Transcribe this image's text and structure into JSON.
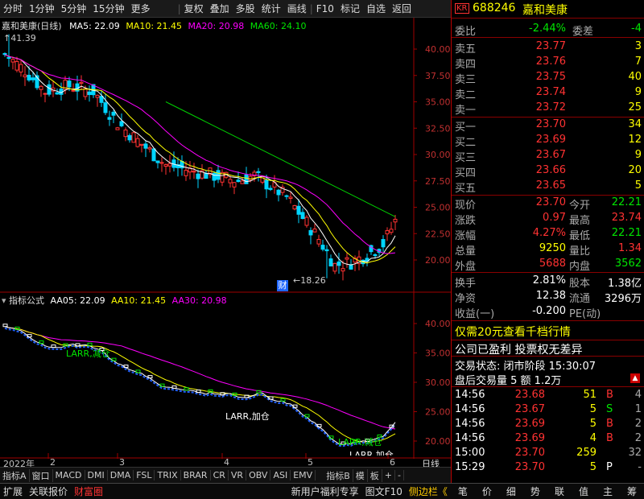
{
  "toolbar": {
    "items": [
      "分时",
      "1分钟",
      "5分钟",
      "15分钟",
      "更多",
      "复权",
      "叠加",
      "多股",
      "统计",
      "画线",
      "F10",
      "标记",
      "自选",
      "返回"
    ]
  },
  "main_chart": {
    "title": "嘉和美康(日线)",
    "ma5": "MA5: 22.09",
    "ma10": "MA10: 21.45",
    "ma20": "MA20: 20.98",
    "ma60": "MA60: 24.10",
    "high_label": "41.39",
    "low_label": "18.26",
    "event_badge": "财",
    "y_ticks": [
      "40.00",
      "37.50",
      "35.00",
      "32.50",
      "30.00",
      "27.50",
      "25.00",
      "22.50",
      "20.00"
    ]
  },
  "indicator": {
    "title": "指标公式",
    "aa05": "AA05: 22.09",
    "aa10": "AA10: 21.45",
    "aa30": "AA30: 20.98",
    "annotations": [
      "LARR,减仓",
      "LARR,加仓",
      "LARR,减仓",
      "LARR,加仓"
    ],
    "y_ticks": [
      "40.00",
      "35.00",
      "30.00",
      "25.00",
      "20.00"
    ]
  },
  "x_axis": {
    "labels": [
      "2022年",
      "2",
      "3",
      "4",
      "5",
      "6"
    ],
    "period": "日线"
  },
  "bottom_tabs": [
    "指标A",
    "窗口",
    "MACD",
    "DMI",
    "DMA",
    "FSL",
    "TRIX",
    "BRAR",
    "CR",
    "VR",
    "OBV",
    "ASI",
    "EMV",
    "指标B",
    "模",
    "板",
    "+",
    "-"
  ],
  "status_bar": {
    "left": [
      "扩展",
      "关联报价",
      "财富圈"
    ],
    "center": [
      "新用户福利专享",
      "图文F10",
      "侧边栏《"
    ],
    "right": [
      "笔",
      "价",
      "细",
      "势",
      "联",
      "值",
      "主",
      "筹"
    ]
  },
  "quote": {
    "code": "688246",
    "name": "嘉和美康",
    "kr_badge": "KR",
    "weibi_label": "委比",
    "weibi_value": "-2.44%",
    "weicha_label": "委差",
    "weicha_value": "-4",
    "asks": [
      {
        "label": "卖五",
        "price": "23.77",
        "vol": "3"
      },
      {
        "label": "卖四",
        "price": "23.76",
        "vol": "7"
      },
      {
        "label": "卖三",
        "price": "23.75",
        "vol": "40"
      },
      {
        "label": "卖二",
        "price": "23.74",
        "vol": "9"
      },
      {
        "label": "卖一",
        "price": "23.72",
        "vol": "25"
      }
    ],
    "bids": [
      {
        "label": "买一",
        "price": "23.70",
        "vol": "34"
      },
      {
        "label": "买二",
        "price": "23.69",
        "vol": "12"
      },
      {
        "label": "买三",
        "price": "23.67",
        "vol": "9"
      },
      {
        "label": "买四",
        "price": "23.66",
        "vol": "20"
      },
      {
        "label": "买五",
        "price": "23.65",
        "vol": "5"
      }
    ],
    "stats": [
      {
        "l1": "现价",
        "v1": "23.70",
        "l2": "今开",
        "v2": "22.21",
        "c1": "red",
        "c2": "green"
      },
      {
        "l1": "涨跌",
        "v1": "0.97",
        "l2": "最高",
        "v2": "23.74",
        "c1": "red",
        "c2": "red"
      },
      {
        "l1": "涨幅",
        "v1": "4.27%",
        "l2": "最低",
        "v2": "22.21",
        "c1": "red",
        "c2": "green"
      },
      {
        "l1": "总量",
        "v1": "9250",
        "l2": "量比",
        "v2": "1.34",
        "c1": "yellow",
        "c2": "red"
      },
      {
        "l1": "外盘",
        "v1": "5688",
        "l2": "内盘",
        "v2": "3562",
        "c1": "red",
        "c2": "green"
      }
    ],
    "stats2": [
      {
        "l1": "换手",
        "v1": "2.81%",
        "l2": "股本",
        "v2": "1.38亿"
      },
      {
        "l1": "净资",
        "v1": "12.38",
        "l2": "流通",
        "v2": "3296万"
      },
      {
        "l1": "收益(一)",
        "v1": "-0.200",
        "l2": "PE(动)",
        "v2": ""
      }
    ],
    "promo": "仅需20元查看千档行情",
    "company_note": "公司已盈利 投票权无差异",
    "trade_status": "交易状态: 闭市阶段 15:30:07",
    "after_hours": "盘后交易量 5 额 1.2万",
    "ticks": [
      {
        "time": "14:56",
        "price": "23.68",
        "vol": "51",
        "dir": "B",
        "n": "4"
      },
      {
        "time": "14:56",
        "price": "23.67",
        "vol": "5",
        "dir": "S",
        "n": "1"
      },
      {
        "time": "14:56",
        "price": "23.69",
        "vol": "5",
        "dir": "B",
        "n": "2"
      },
      {
        "time": "14:56",
        "price": "23.69",
        "vol": "4",
        "dir": "B",
        "n": "2"
      },
      {
        "time": "15:00",
        "price": "23.70",
        "vol": "259",
        "dir": "",
        "n": "32"
      },
      {
        "time": "15:29",
        "price": "23.70",
        "vol": "5",
        "dir": "P",
        "n": "-"
      }
    ]
  }
}
